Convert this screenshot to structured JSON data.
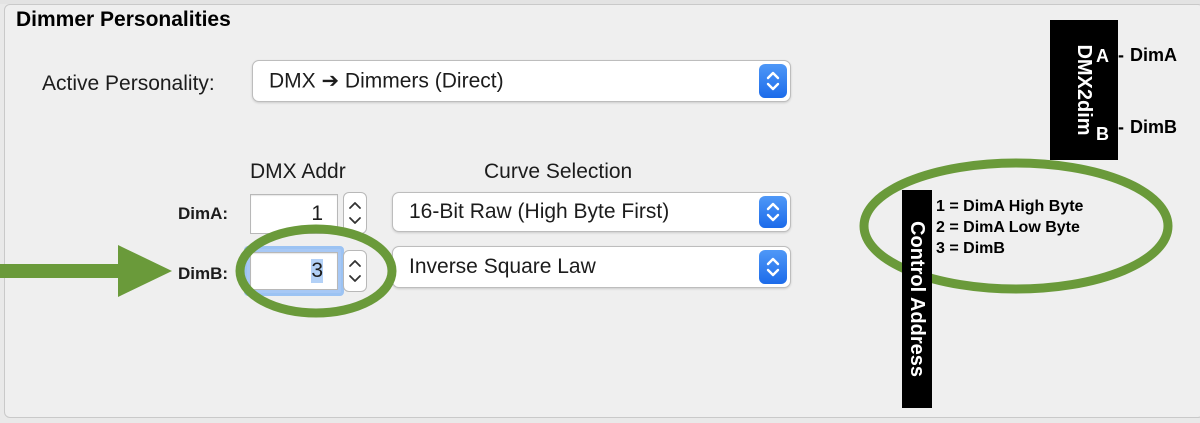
{
  "section_title": "Dimmer Personalities",
  "active_personality": {
    "label": "Active Personality:",
    "value": "DMX ➔ Dimmers (Direct)"
  },
  "columns": {
    "dmx_addr": "DMX Addr",
    "curve": "Curve Selection"
  },
  "rows": [
    {
      "label": "DimA:",
      "addr": "1",
      "curve": "16-Bit Raw (High Byte First)"
    },
    {
      "label": "DimB:",
      "addr": "3",
      "curve": "Inverse Square Law"
    }
  ],
  "device_diagram": {
    "name": "DMX2dim",
    "pins": [
      {
        "pin": "A",
        "sep": "-",
        "name": "DimA"
      },
      {
        "pin": "B",
        "sep": "-",
        "name": "DimB"
      }
    ]
  },
  "control_address": {
    "label": "Control Address",
    "lines": [
      "1 = DimA High Byte",
      "2 = DimA Low Byte",
      "3 = DimB"
    ]
  },
  "colors": {
    "annotation_green": "#6a9a3a",
    "accent_blue": "#2f7ff0"
  },
  "icons": {
    "popup_arrows": "updown-chevron-icon",
    "stepper": "stepper-arrows-icon",
    "callout": "green-arrow-icon"
  }
}
